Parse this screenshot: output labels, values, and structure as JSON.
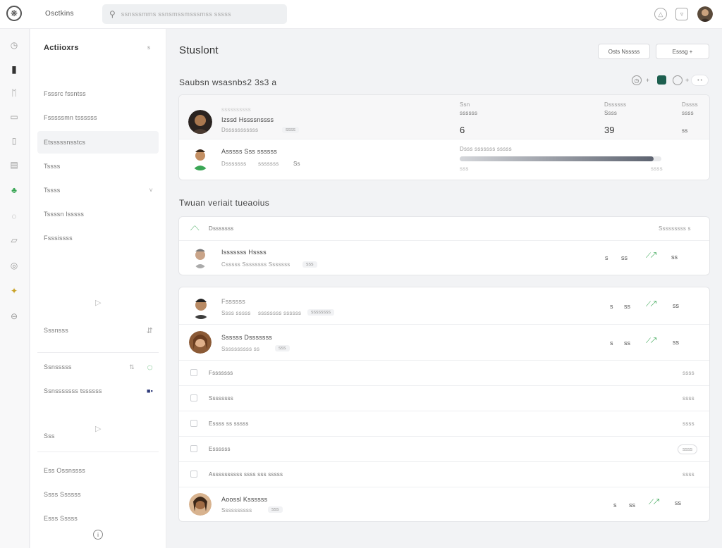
{
  "app": {
    "name": "Osctkins",
    "search_placeholder": "ssnsssmms ssnsmssmsssmss sssss"
  },
  "sidebar": {
    "header": "Actiioxrs",
    "header_trail": "s",
    "items": [
      {
        "label": "Fsssrc fssntss",
        "trail": ""
      },
      {
        "label": "Fsssssmn tssssss",
        "trail": ""
      },
      {
        "label": "Etsssssnsstcs",
        "trail": ""
      },
      {
        "label": "Tssss",
        "trail": ""
      },
      {
        "label": "Tssss",
        "trail": "˅"
      },
      {
        "label": "Tssssn lsssss",
        "trail": ""
      },
      {
        "label": "Fsssissss",
        "trail": ""
      },
      {
        "label": "Sssnsss",
        "trail": ""
      },
      {
        "label": "Ssnsssss",
        "trail": "⇅"
      },
      {
        "label": "Ssnsssssss tssssss",
        "trail": ""
      },
      {
        "label": "Sss",
        "trail": ""
      },
      {
        "label": "Ess Ossnssss",
        "trail": ""
      },
      {
        "label": "Ssss Ssssss",
        "trail": ""
      },
      {
        "label": "Esss Sssss",
        "trail": ""
      }
    ],
    "footer_icon": "info-icon"
  },
  "main": {
    "title": "Stuslont",
    "buttons": {
      "secondary": "Osts Nsssss",
      "primary": "Esssg +"
    },
    "section1": {
      "title": "Saubsn wsasnbs2 3s3 a",
      "stat_headers": [
        {
          "label": "Ssn",
          "sub": "ssssss"
        },
        {
          "label": "Dssssss",
          "sub": "Ssss"
        },
        {
          "label": "Dssss",
          "sub": "ssss"
        }
      ],
      "people": [
        {
          "top": "ssssssssss",
          "name": "Izssd Hssssnssss",
          "meta": "Dsssssssssss",
          "chip": "ssss"
        },
        {
          "top": "",
          "name": "Asssss Sss ssssss",
          "meta": "Dsssssss",
          "chip": "sssssss",
          "chip2": "Ss"
        }
      ],
      "values": [
        "6",
        "39",
        "ss"
      ],
      "progress": {
        "label": "Dsss sssssss sssss",
        "left": "sss",
        "right": "ssss",
        "value": 0.96
      }
    },
    "section2": {
      "title": "Twuan veriait tueaoius",
      "header_label": "Dsssssss",
      "header_right": "Sssssssss s",
      "rows": [
        {
          "name": "Isssssss Hssss",
          "meta": "Csssss Ssssssss Sssssss",
          "chip": "sss",
          "a": "s",
          "b": "ss",
          "c": "ss"
        }
      ]
    },
    "section3": {
      "people": [
        {
          "name": "Fssssss",
          "meta": "Ssss sssss",
          "chip": "ssssssss ssssss",
          "chip2": "ssssssss",
          "a": "s",
          "b": "ss",
          "c": "ss"
        },
        {
          "name": "Ssssss Dsssssss",
          "meta": "Ssssssssss ss",
          "chip": "sss",
          "a": "s",
          "b": "ss",
          "c": "ss"
        }
      ],
      "rows": [
        {
          "label": "Fsssssss",
          "right": "ssss"
        },
        {
          "label": "Ssssssss",
          "right": "ssss"
        },
        {
          "label": "Essss ss sssss",
          "right": "ssss"
        },
        {
          "label": "Essssss",
          "right": "ssss"
        },
        {
          "label": "Assssssssss ssss sss sssss",
          "right": "ssss"
        }
      ],
      "last_person": {
        "name": "Aoossl Kssssss",
        "meta": "Ssssssssss",
        "chip": "sss",
        "a": "s",
        "b": "ss",
        "c": "ss"
      }
    }
  }
}
